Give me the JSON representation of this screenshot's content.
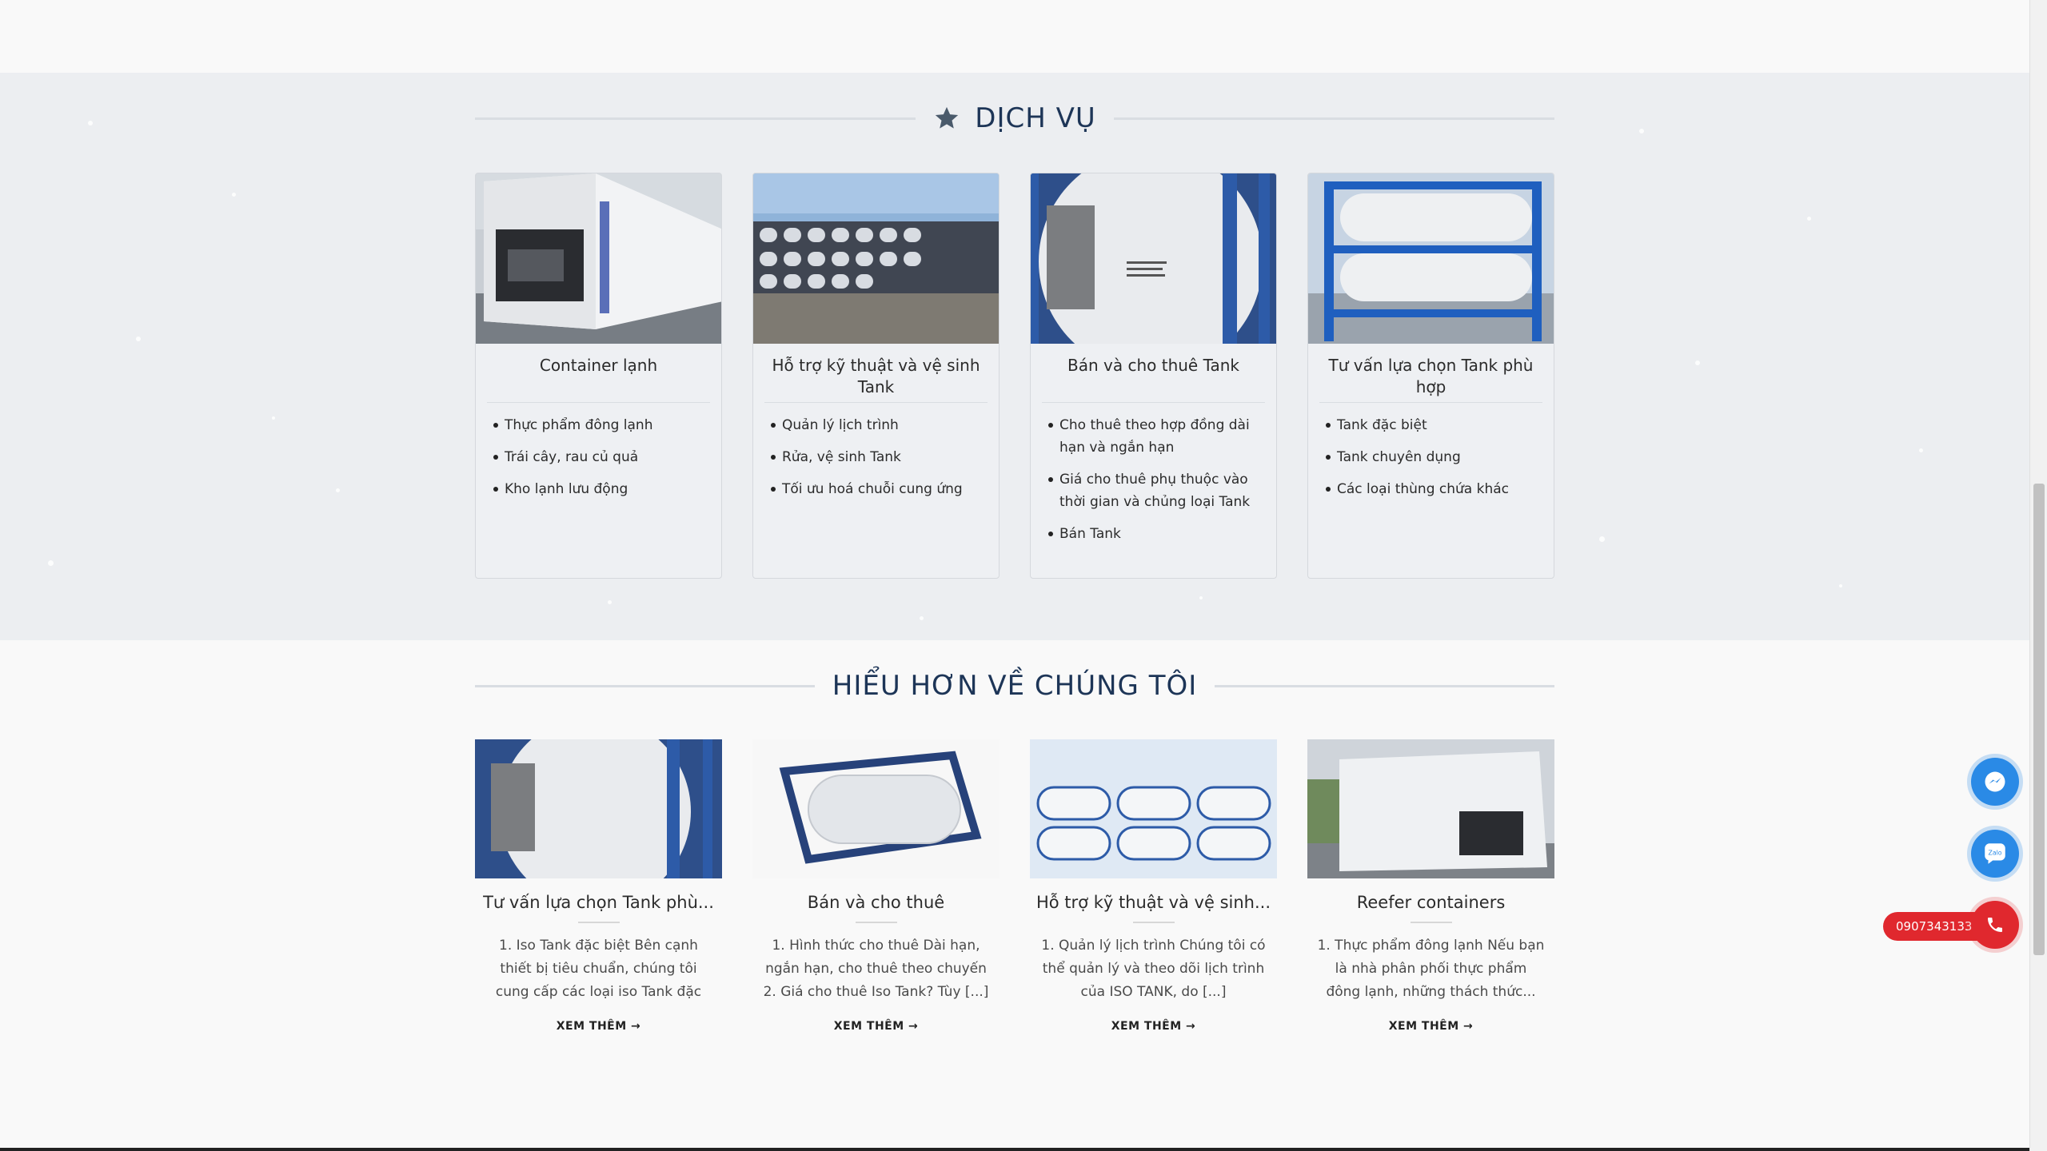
{
  "services": {
    "title": "DỊCH VỤ",
    "title_icon": "star-icon",
    "cards": [
      {
        "title": "Container lạnh",
        "items": [
          "Thực phẩm đông lạnh",
          "Trái cây, rau củ quả",
          "Kho lạnh lưu động"
        ]
      },
      {
        "title": "Hỗ trợ kỹ thuật và vệ sinh Tank",
        "items": [
          "Quản lý lịch trình",
          "Rửa, vệ sinh Tank",
          "Tối ưu hoá chuỗi cung ứng"
        ]
      },
      {
        "title": "Bán và cho thuê Tank",
        "items": [
          "Cho thuê theo hợp đồng dài hạn và ngắn hạn",
          "Giá cho thuê phụ thuộc vào thời gian và chủng loại Tank",
          "Bán Tank"
        ]
      },
      {
        "title": "Tư vấn lựa chọn Tank phù hợp",
        "items": [
          "Tank đặc biệt",
          "Tank chuyên dụng",
          "Các loại thùng chứa khác"
        ]
      }
    ]
  },
  "about": {
    "title": "HIỂU HƠN VỀ CHÚNG TÔI",
    "posts": [
      {
        "title": "Tư vấn lựa chọn Tank phù...",
        "excerpt": "1. Iso Tank đặc biệt Bên cạnh thiết bị tiêu chuẩn, chúng tôi cung cấp các loại iso Tank đặc [...]",
        "read_more": "XEM THÊM →"
      },
      {
        "title": "Bán và cho thuê",
        "excerpt": "1. Hình thức cho thuê Dài hạn, ngắn hạn, cho thuê theo chuyến 2. Giá cho thuê Iso Tank? Tùy [...]",
        "read_more": "XEM THÊM →"
      },
      {
        "title": "Hỗ trợ kỹ thuật và vệ sinh...",
        "excerpt": "1. Quản lý lịch trình Chúng tôi có thể quản lý và theo dõi lịch trình của ISO TANK, do [...]",
        "read_more": "XEM THÊM →"
      },
      {
        "title": "Reefer containers",
        "excerpt": "1. Thực phẩm đông lạnh Nếu bạn là nhà phân phối thực phẩm đông lạnh, những thách thức...",
        "read_more": "XEM THÊM →"
      }
    ]
  },
  "floating": {
    "messenger_icon": "messenger-icon",
    "zalo_icon": "zalo-icon",
    "phone_number": "0907343133",
    "phone_icon": "phone-icon"
  },
  "colors": {
    "heading": "#1d3557",
    "phone_red": "#e0282e",
    "float_blue": "#2a8ae6"
  }
}
